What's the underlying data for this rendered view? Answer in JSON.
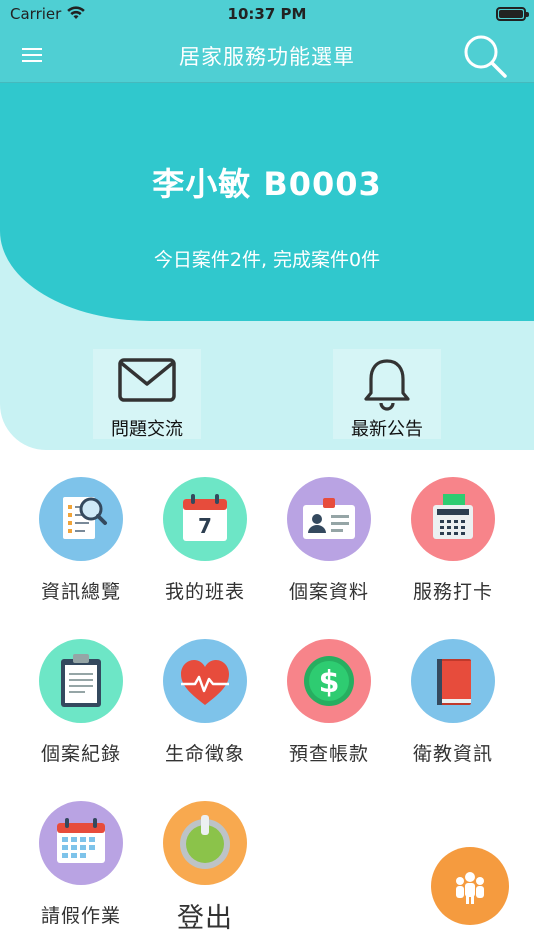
{
  "status_bar": {
    "carrier": "Carrier",
    "time": "10:37 PM"
  },
  "nav": {
    "title": "居家服務功能選單",
    "menu_icon": "hamburger-menu-icon",
    "search_icon": "search-icon"
  },
  "header": {
    "user_name": "李小敏 B0003",
    "case_summary": "今日案件2件, 完成案件0件"
  },
  "quick_actions": [
    {
      "label": "問題交流",
      "icon": "envelope-icon"
    },
    {
      "label": "最新公告",
      "icon": "bell-icon"
    }
  ],
  "calendar_day": "7",
  "fee_symbol": "$",
  "menu": [
    {
      "label": "資訊總覽",
      "icon": "report-magnifier-icon",
      "color": "#7ec3ea"
    },
    {
      "label": "我的班表",
      "icon": "calendar-icon",
      "color": "#6de6c6"
    },
    {
      "label": "個案資料",
      "icon": "id-card-icon",
      "color": "#b9a3e3"
    },
    {
      "label": "服務打卡",
      "icon": "punch-clock-icon",
      "color": "#f7848a"
    },
    {
      "label": "個案紀錄",
      "icon": "clipboard-icon",
      "color": "#6de6c6"
    },
    {
      "label": "生命徵象",
      "icon": "heart-pulse-icon",
      "color": "#7ec3ea"
    },
    {
      "label": "預查帳款",
      "icon": "dollar-coin-icon",
      "color": "#f7848a"
    },
    {
      "label": "衛教資訊",
      "icon": "book-icon",
      "color": "#7ec3ea"
    },
    {
      "label": "請假作業",
      "icon": "leave-calendar-icon",
      "color": "#b9a3e3"
    },
    {
      "label": "登出",
      "icon": "power-icon",
      "color": "#f8a94f"
    }
  ],
  "fab": {
    "icon": "group-people-icon",
    "color": "#f59b3f"
  }
}
